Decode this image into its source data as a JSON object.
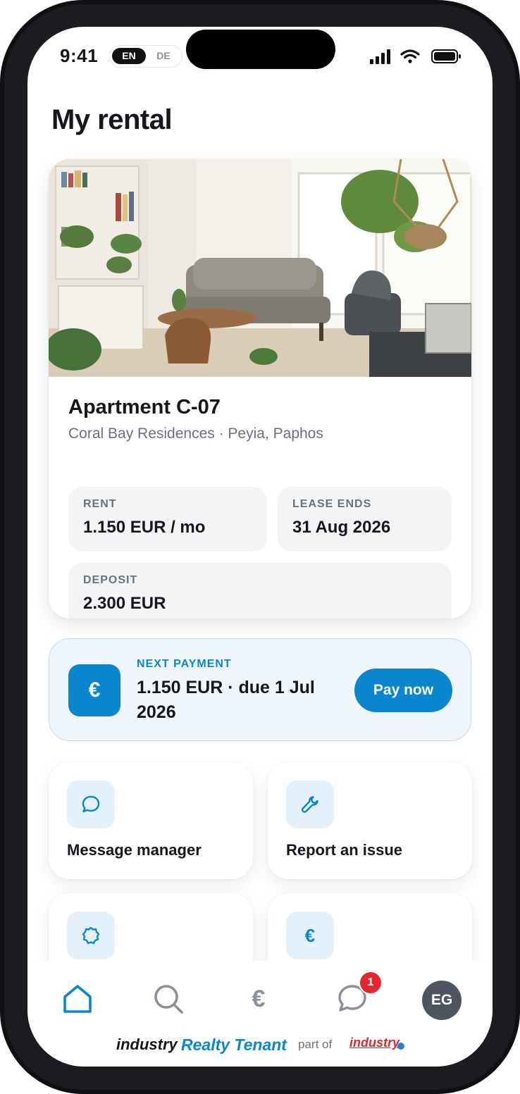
{
  "status_bar": {
    "time": "9:41",
    "languages": [
      "EN",
      "DE"
    ],
    "active_language": "EN"
  },
  "page": {
    "title": "My rental"
  },
  "property": {
    "name": "Apartment C-07",
    "location": "Coral Bay Residences · Peyia, Paphos",
    "stats": [
      {
        "label": "RENT",
        "value": "1.150 EUR / mo"
      },
      {
        "label": "LEASE ENDS",
        "value": "31 Aug 2026"
      },
      {
        "label": "DEPOSIT",
        "value": "2.300 EUR"
      }
    ]
  },
  "next_payment": {
    "label": "NEXT PAYMENT",
    "amount": "1.150 EUR · due 1 Jul 2026",
    "icon": "€",
    "button": "Pay now"
  },
  "actions": [
    {
      "label": "Message manager",
      "icon": "chat-icon"
    },
    {
      "label": "Report an issue",
      "icon": "wrench-icon"
    },
    {
      "label": "",
      "icon": "badge-icon"
    },
    {
      "label": "",
      "icon": "euro-icon",
      "glyph": "€"
    }
  ],
  "nav": {
    "items": [
      "home-icon",
      "search-icon",
      "euro-icon",
      "chat-icon",
      "avatar"
    ],
    "active": "home-icon",
    "messages_badge": "1",
    "avatar_initials": "EG",
    "nav_euro_glyph": "€"
  },
  "footer": {
    "brand_prefix": "industry",
    "brand_name": "Realty Tenant",
    "part_of": "part of",
    "parent_brand": "industry"
  },
  "colors": {
    "accent": "#0a86cf",
    "badge": "#e0282e",
    "avatar": "#4d5561"
  }
}
